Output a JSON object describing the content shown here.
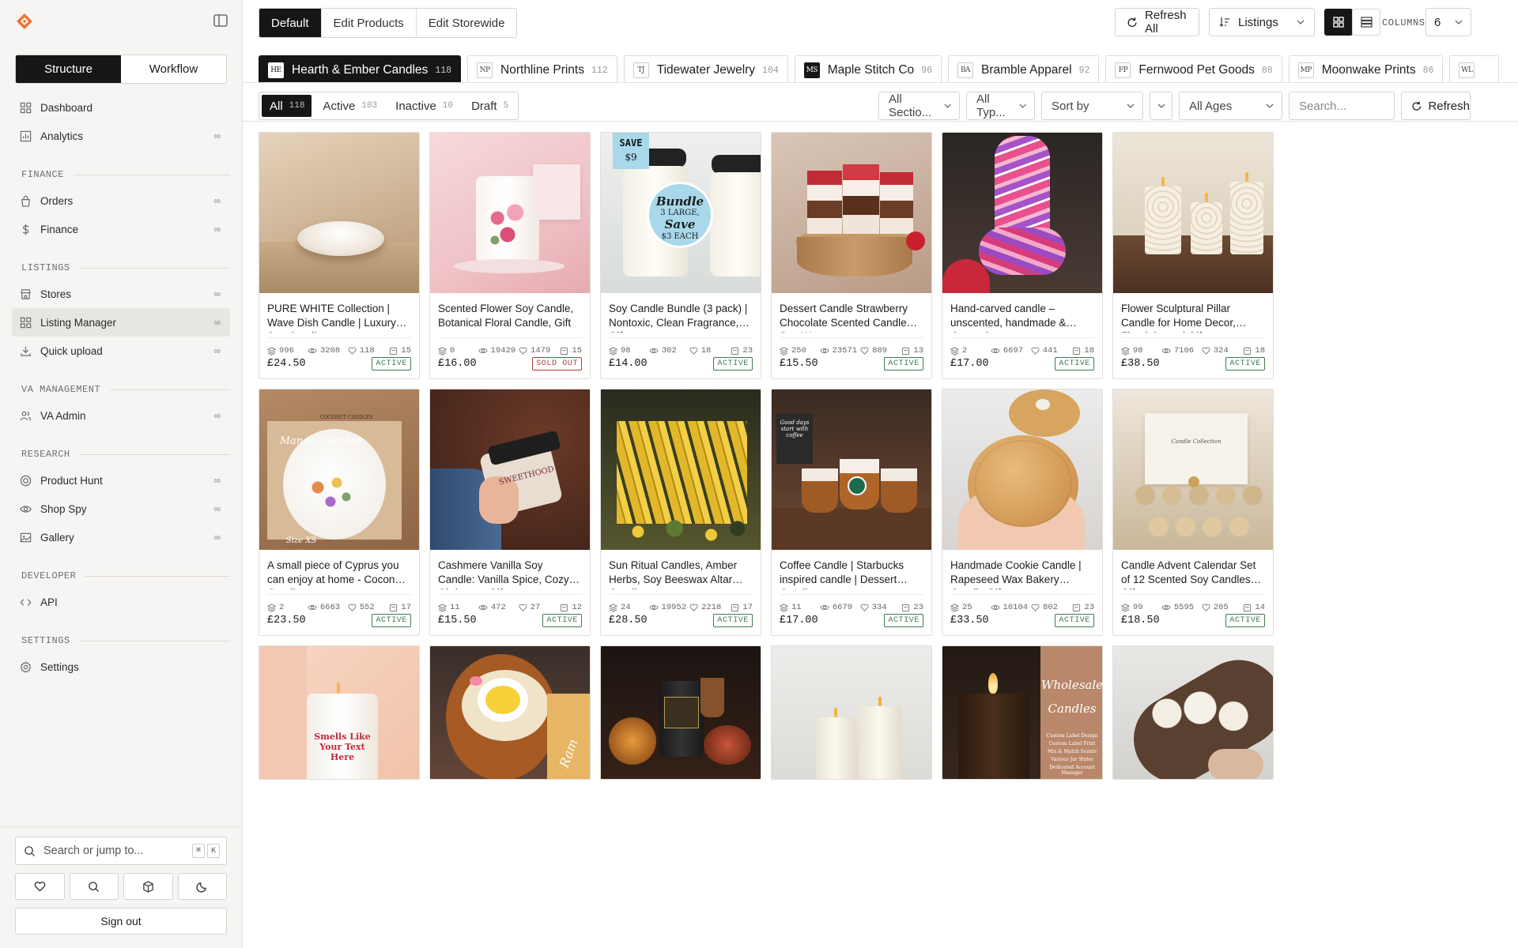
{
  "sidebar": {
    "tabs": [
      "Structure",
      "Workflow"
    ],
    "items": [
      {
        "label": "Dashboard",
        "icon": "grid-icon",
        "suffix": ""
      },
      {
        "label": "Analytics",
        "icon": "chart-icon",
        "suffix": "∞"
      },
      {
        "section": "FINANCE"
      },
      {
        "label": "Orders",
        "icon": "bag-icon",
        "suffix": "∞"
      },
      {
        "label": "Finance",
        "icon": "dollar-icon",
        "suffix": "∞"
      },
      {
        "section": "LISTINGS"
      },
      {
        "label": "Stores",
        "icon": "store-icon",
        "suffix": "∞"
      },
      {
        "label": "Listing Manager",
        "icon": "grid-icon",
        "suffix": "∞",
        "active": true
      },
      {
        "label": "Quick upload",
        "icon": "download-icon",
        "suffix": "∞"
      },
      {
        "section": "VA MANAGEMENT"
      },
      {
        "label": "VA Admin",
        "icon": "users-icon",
        "suffix": "∞"
      },
      {
        "section": "RESEARCH"
      },
      {
        "label": "Product Hunt",
        "icon": "target-icon",
        "suffix": "∞"
      },
      {
        "label": "Shop Spy",
        "icon": "eye-icon",
        "suffix": "∞"
      },
      {
        "label": "Gallery",
        "icon": "image-icon",
        "suffix": "∞"
      },
      {
        "section": "DEVELOPER"
      },
      {
        "label": "API",
        "icon": "code-icon",
        "suffix": ""
      },
      {
        "section": "SETTINGS"
      },
      {
        "label": "Settings",
        "icon": "gear-icon",
        "suffix": ""
      }
    ],
    "search_placeholder": "Search or jump to...",
    "kbd": [
      "⌘",
      "K"
    ],
    "sign_out": "Sign out"
  },
  "toolbar": {
    "modes": [
      "Default",
      "Edit Products",
      "Edit Storewide"
    ],
    "refresh_all": "Refresh All",
    "listings": "Listings",
    "columns_label": "COLUMNS",
    "columns_value": "6"
  },
  "stores": [
    {
      "mono": "HE",
      "name": "Hearth & Ember Candles",
      "count": "118",
      "on": true
    },
    {
      "mono": "NP",
      "name": "Northline Prints",
      "count": "112"
    },
    {
      "mono": "TJ",
      "name": "Tidewater Jewelry",
      "count": "104"
    },
    {
      "mono": "MS",
      "name": "Maple Stitch Co",
      "count": "96",
      "dark": true
    },
    {
      "mono": "BA",
      "name": "Bramble Apparel",
      "count": "92"
    },
    {
      "mono": "FP",
      "name": "Fernwood Pet Goods",
      "count": "88"
    },
    {
      "mono": "MP",
      "name": "Moonwake Prints",
      "count": "86"
    },
    {
      "mono": "WL",
      "name": "",
      "count": ""
    }
  ],
  "status_tabs": [
    {
      "label": "All",
      "count": "118"
    },
    {
      "label": "Active",
      "count": "103"
    },
    {
      "label": "Inactive",
      "count": "10"
    },
    {
      "label": "Draft",
      "count": "5"
    }
  ],
  "filters": {
    "sections": "All Sectio...",
    "types": "All Typ...",
    "sort": "Sort by",
    "ages": "All Ages",
    "search_placeholder": "Search...",
    "refresh": "Refresh"
  },
  "products": [
    {
      "title": "PURE WHITE Collection | Wave Dish Candle | Luxury Soy Candle",
      "s1": "996",
      "s2": "3208",
      "s3": "118",
      "s4": "15",
      "price": "£24.50",
      "status": "ACTIVE"
    },
    {
      "title": "Scented Flower Soy Candle, Botanical Floral Candle, Gift",
      "s1": "0",
      "s2": "19429",
      "s3": "1479",
      "s4": "15",
      "price": "£16.00",
      "status": "SOLD OUT"
    },
    {
      "title": "Soy Candle Bundle (3 pack) | Nontoxic, Clean Fragrance, Gift",
      "s1": "98",
      "s2": "302",
      "s3": "18",
      "s4": "23",
      "price": "£14.00",
      "status": "ACTIVE",
      "overlay": {
        "save": "SAVE",
        "amount": "$9",
        "bundle": "Bundle",
        "large": "3 LARGE,",
        "save2": "Save",
        "each": "$3 EACH"
      }
    },
    {
      "title": "Dessert Candle Strawberry Chocolate Scented Candle Soy Wax",
      "s1": "250",
      "s2": "23571",
      "s3": "889",
      "s4": "13",
      "price": "£15.50",
      "status": "ACTIVE"
    },
    {
      "title": "Hand-carved candle – unscented, handmade & decorative",
      "s1": "2",
      "s2": "6697",
      "s3": "441",
      "s4": "18",
      "price": "£17.00",
      "status": "ACTIVE"
    },
    {
      "title": "Flower Sculptural Pillar Candle for Home Decor, Floral Carved Gift",
      "s1": "98",
      "s2": "7106",
      "s3": "324",
      "s4": "18",
      "price": "£38.50",
      "status": "ACTIVE"
    },
    {
      "title": "A small piece of Cyprus you can enjoy at home - Coconut Candle",
      "s1": "2",
      "s2": "6663",
      "s3": "552",
      "s4": "17",
      "price": "£23.50",
      "status": "ACTIVE",
      "overlay": {
        "t1": "Mango Coconut",
        "t2": "COCONUT CANDLES",
        "t3": "Size XS"
      }
    },
    {
      "title": "Cashmere Vanilla Soy Candle: Vanilla Spice, Cozy Christmas Gift",
      "s1": "11",
      "s2": "472",
      "s3": "27",
      "s4": "12",
      "price": "£15.50",
      "status": "ACTIVE",
      "overlay": {
        "t1": "SWEETHOOD"
      }
    },
    {
      "title": "Sun Ritual Candles, Amber Herbs, Soy Beeswax Altar Candles",
      "s1": "24",
      "s2": "19952",
      "s3": "2218",
      "s4": "17",
      "price": "£28.50",
      "status": "ACTIVE"
    },
    {
      "title": "Coffee Candle | Starbucks inspired candle | Dessert Candle",
      "s1": "11",
      "s2": "6679",
      "s3": "334",
      "s4": "23",
      "price": "£17.00",
      "status": "ACTIVE",
      "overlay": {
        "t1": "Good days start with coffee"
      }
    },
    {
      "title": "Handmade Cookie Candle | Rapeseed Wax Bakery Candle Gift",
      "s1": "25",
      "s2": "10104",
      "s3": "802",
      "s4": "23",
      "price": "£33.50",
      "status": "ACTIVE"
    },
    {
      "title": "Candle Advent Calendar Set of 12 Scented Soy Candles Gift",
      "s1": "99",
      "s2": "5595",
      "s3": "205",
      "s4": "14",
      "price": "£18.50",
      "status": "ACTIVE",
      "overlay": {
        "t1": "Candle Collection"
      }
    },
    {
      "overlay": {
        "t1": "Smells Like Your Text Here"
      }
    },
    {
      "overlay": {
        "t1": "Ram"
      }
    },
    {},
    {},
    {
      "overlay": {
        "t1": "Wholesale",
        "t2": "Candles",
        "t3": "Custom Label Design",
        "t4": "Custom Label Print",
        "t5": "Mix & Match Scents",
        "t6": "Various Jar Styles",
        "t7": "Dedicated Account Manager"
      }
    },
    {}
  ],
  "colors": {
    "accent": "#161616",
    "active": "#3f7a52",
    "sold": "#b43a3a",
    "logo": "#e8743b"
  }
}
